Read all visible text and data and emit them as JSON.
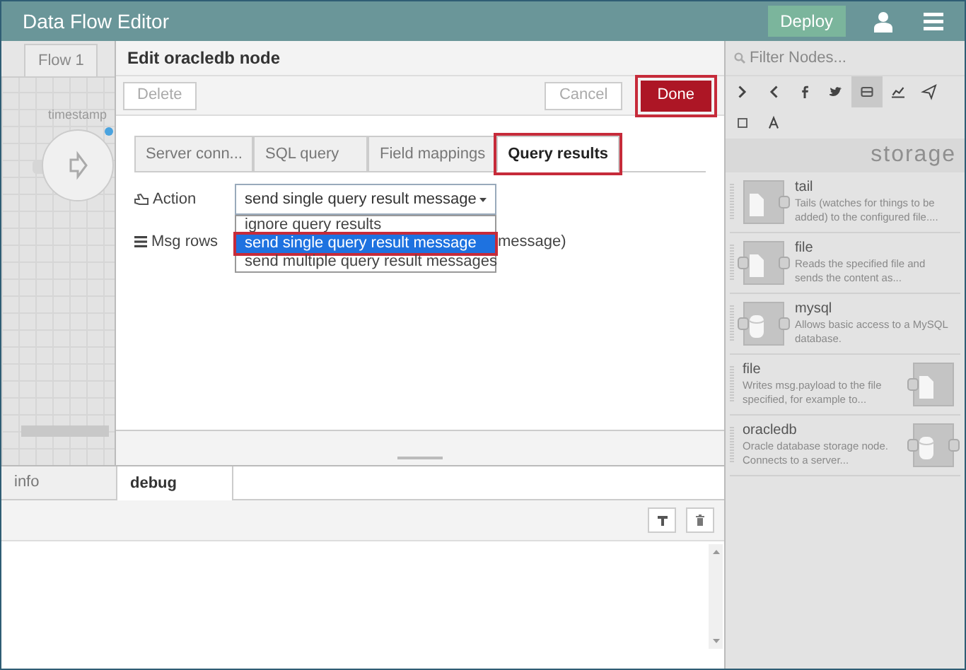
{
  "window": {
    "title": "Data Flow Editor"
  },
  "deploy": "Deploy",
  "workspace": {
    "tabs": [
      {
        "label": "Flow 1",
        "selected": true
      }
    ],
    "nodes": [
      {
        "label": "timestamp"
      }
    ]
  },
  "edit_tray": {
    "title": "Edit oracledb node",
    "delete": "Delete",
    "cancel": "Cancel",
    "done": {
      "label": "Done",
      "highlighted": true
    },
    "tabs": [
      {
        "label": "Server conn...",
        "selected": false,
        "highlighted": false
      },
      {
        "label": "SQL query",
        "selected": false,
        "highlighted": false
      },
      {
        "label": "Field mappings",
        "selected": false,
        "highlighted": false
      },
      {
        "label": "Query results",
        "selected": true,
        "highlighted": true
      }
    ],
    "fields": [
      {
        "kind": "action",
        "label": "Action"
      },
      {
        "kind": "rows",
        "label": "Msg rows",
        "value": "message)"
      }
    ],
    "select": {
      "value": "send single query result message",
      "options": [
        {
          "label": "ignore query results",
          "selected": false,
          "highlighted": false
        },
        {
          "label": "send single query result message",
          "selected": true,
          "highlighted": true
        },
        {
          "label": "send multiple query result messages",
          "selected": false,
          "highlighted": false
        }
      ]
    }
  },
  "palette": {
    "placeholder": "Filter Nodes...",
    "categories": [
      {
        "kind": "next",
        "selected": false
      },
      {
        "kind": "prev",
        "selected": false
      },
      {
        "kind": "facebook",
        "selected": false
      },
      {
        "kind": "twitter",
        "selected": false
      },
      {
        "kind": "storage",
        "selected": true
      },
      {
        "kind": "chart",
        "selected": false
      },
      {
        "kind": "send",
        "selected": false
      },
      {
        "kind": "checkbox",
        "selected": false
      },
      {
        "kind": "font",
        "selected": false
      }
    ],
    "section": "storage",
    "nodes": [
      {
        "name": "tail",
        "description": "Tails (watches for things to be added) to the configured file....",
        "icon_right": false,
        "kind": "file",
        "inputs": false,
        "outputs": true
      },
      {
        "name": "file",
        "description": "Reads the specified file and sends the content as...",
        "icon_right": false,
        "kind": "file",
        "inputs": true,
        "outputs": true
      },
      {
        "name": "mysql",
        "description": "Allows basic access to a MySQL database.",
        "icon_right": false,
        "kind": "database",
        "inputs": true,
        "outputs": true
      },
      {
        "name": "file",
        "description": "Writes msg.payload to the file specified, for example to...",
        "icon_right": true,
        "kind": "file",
        "inputs": true,
        "outputs": false
      },
      {
        "name": "oracledb",
        "description": "Oracle database storage node. Connects to a server...",
        "icon_right": true,
        "kind": "database",
        "inputs": true,
        "outputs": true
      }
    ]
  },
  "bottom_panel": {
    "tabs": [
      {
        "label": "info",
        "selected": false
      },
      {
        "label": "debug",
        "selected": true
      }
    ]
  }
}
